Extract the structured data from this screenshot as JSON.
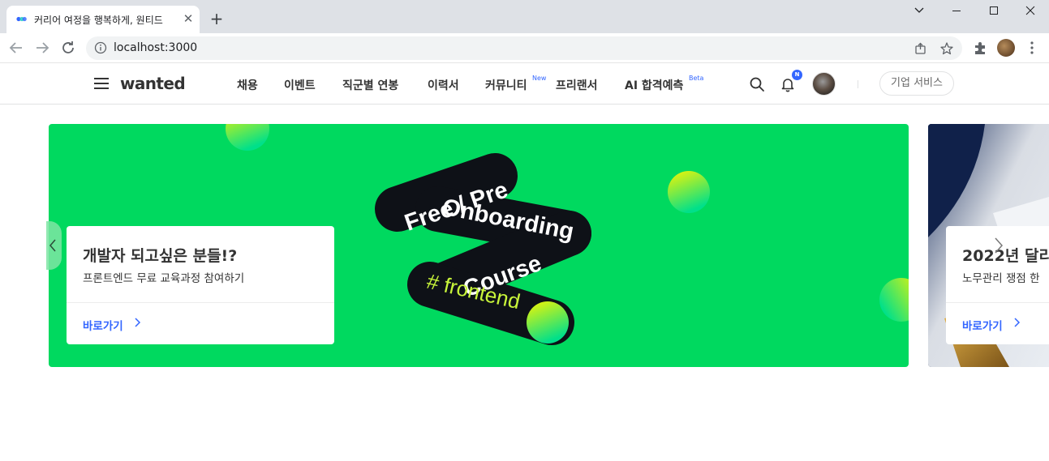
{
  "browser": {
    "tab_title": "커리어 여정을 행복하게, 원티드",
    "url": "localhost:3000",
    "new_tab_symbol": "+",
    "close_symbol": "✕"
  },
  "header": {
    "logo": "wanted",
    "menu": [
      {
        "label": "채용"
      },
      {
        "label": "이벤트"
      },
      {
        "label": "직군별 연봉"
      },
      {
        "label": "이력서"
      },
      {
        "label": "커뮤니티",
        "sup": "New"
      },
      {
        "label": "프리랜서"
      },
      {
        "label": "AI 합격예측",
        "sup": "Beta"
      }
    ],
    "notification_badge": "N",
    "business_button": "기업 서비스"
  },
  "banner": {
    "main": {
      "title": "개발자 되고싶은 분들!?",
      "subtitle": "프론트엔드 무료 교육과정 참여하기",
      "link": "바로가기",
      "art_lines": [
        "Free / Pre",
        "Onboarding",
        "Course",
        "# frontend"
      ],
      "background": "#00d95f"
    },
    "next": {
      "title": "2022년 달리",
      "subtitle": "노무관리 쟁점 한",
      "link": "바로가기"
    }
  },
  "colors": {
    "accent": "#3366ff",
    "banner_green": "#00d95f"
  }
}
